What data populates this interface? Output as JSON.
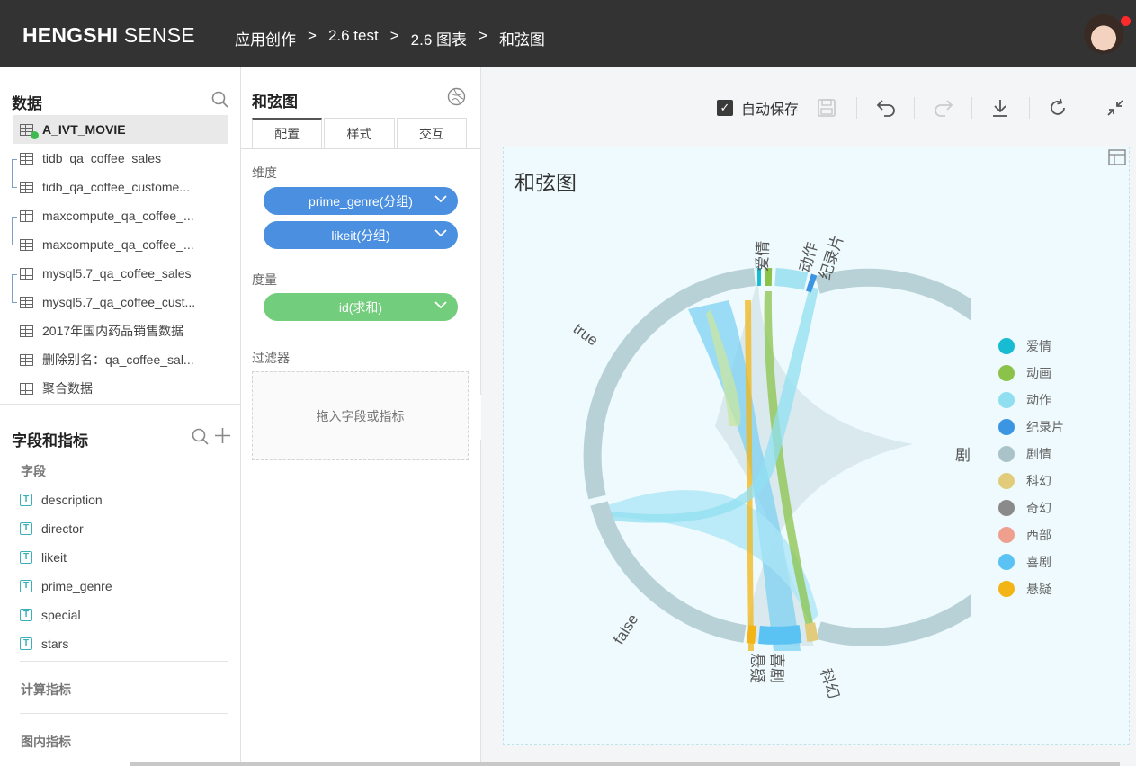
{
  "topbar": {
    "brand_bold": "HENGSHI",
    "brand_rest": "SENSE",
    "breadcrumbs": [
      "应用创作",
      "2.6 test",
      "2.6 图表",
      "和弦图"
    ],
    "breadcrumb_separator": ">"
  },
  "datasets": {
    "title": "数据",
    "items": [
      {
        "label": "A_IVT_MOVIE",
        "active": true
      },
      {
        "label": "tidb_qa_coffee_sales"
      },
      {
        "label": "tidb_qa_coffee_custome..."
      },
      {
        "label": "maxcompute_qa_coffee_..."
      },
      {
        "label": "maxcompute_qa_coffee_..."
      },
      {
        "label": "mysql5.7_qa_coffee_sales"
      },
      {
        "label": "mysql5.7_qa_coffee_cust..."
      },
      {
        "label": "2017年国内药品销售数据"
      },
      {
        "label": "删除别名：qa_coffee_sal..."
      },
      {
        "label": "聚合数据"
      }
    ]
  },
  "fields": {
    "title": "字段和指标",
    "section_fields": "字段",
    "items": [
      "description",
      "director",
      "likeit",
      "prime_genre",
      "special",
      "stars"
    ],
    "section_calc": "计算指标",
    "section_chart": "图内指标"
  },
  "config": {
    "title": "和弦图",
    "tabs": [
      "配置",
      "样式",
      "交互"
    ],
    "dimension_label": "维度",
    "dimensions": [
      "prime_genre(分组)",
      "likeit(分组)"
    ],
    "measure_label": "度量",
    "measures": [
      "id(求和)"
    ],
    "filter_label": "过滤器",
    "filter_placeholder": "拖入字段或指标"
  },
  "toolbar": {
    "autosave_label": "自动保存",
    "autosave_checked": true
  },
  "chart": {
    "title": "和弦图",
    "arc_labels": [
      "爱情",
      "动作",
      "纪录片",
      "剧情",
      "科幻",
      "喜剧",
      "悬疑",
      "false",
      "true"
    ],
    "legend": [
      {
        "name": "爱情",
        "color": "#17bcd3"
      },
      {
        "name": "动画",
        "color": "#8bc34a"
      },
      {
        "name": "动作",
        "color": "#90dff0"
      },
      {
        "name": "纪录片",
        "color": "#3b95e2"
      },
      {
        "name": "剧情",
        "color": "#a9c3c8"
      },
      {
        "name": "科幻",
        "color": "#e2cc7c"
      },
      {
        "name": "奇幻",
        "color": "#8a8a8a"
      },
      {
        "name": "西部",
        "color": "#ef9f8e"
      },
      {
        "name": "喜剧",
        "color": "#5bc3f4"
      },
      {
        "name": "悬疑",
        "color": "#f2b515"
      }
    ]
  }
}
